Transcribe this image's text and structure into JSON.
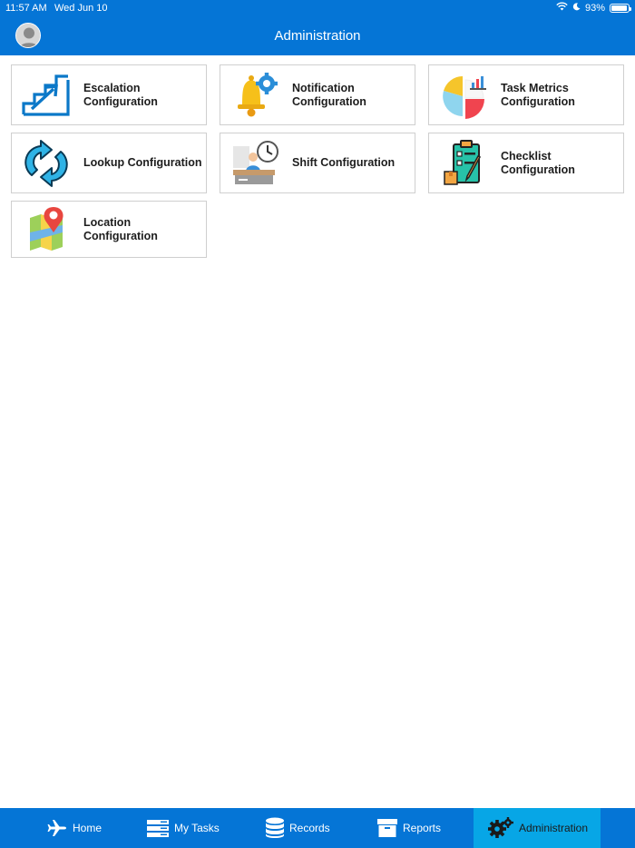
{
  "status_bar": {
    "time": "11:57 AM",
    "date": "Wed Jun 10",
    "battery": "93%",
    "battery_level": 0.93,
    "icons": [
      "wifi-icon",
      "moon-icon",
      "battery-icon"
    ]
  },
  "header": {
    "title": "Administration",
    "avatar_icon": "user-avatar-icon"
  },
  "colors": {
    "brand_blue": "#0575d6",
    "active_tab": "#07a6e6",
    "tile_border": "#cfcfcf"
  },
  "tiles": [
    {
      "label": "Escalation Configuration",
      "icon": "escalation-stairs-icon"
    },
    {
      "label": "Notification Configuration",
      "icon": "bell-gear-icon"
    },
    {
      "label": "Task Metrics Configuration",
      "icon": "pie-chart-icon"
    },
    {
      "label": "Lookup Configuration",
      "icon": "refresh-arrows-icon"
    },
    {
      "label": "Shift Configuration",
      "icon": "worker-clock-icon"
    },
    {
      "label": "Checklist Configuration",
      "icon": "clipboard-checklist-icon"
    },
    {
      "label": "Location Configuration",
      "icon": "map-pin-icon"
    }
  ],
  "tabbar": {
    "items": [
      {
        "label": "Home",
        "icon": "airplane-icon"
      },
      {
        "label": "My Tasks",
        "icon": "tasks-list-icon"
      },
      {
        "label": "Records",
        "icon": "database-icon"
      },
      {
        "label": "Reports",
        "icon": "archive-box-icon"
      },
      {
        "label": "Administration",
        "icon": "gears-icon"
      }
    ],
    "active": "Administration"
  }
}
